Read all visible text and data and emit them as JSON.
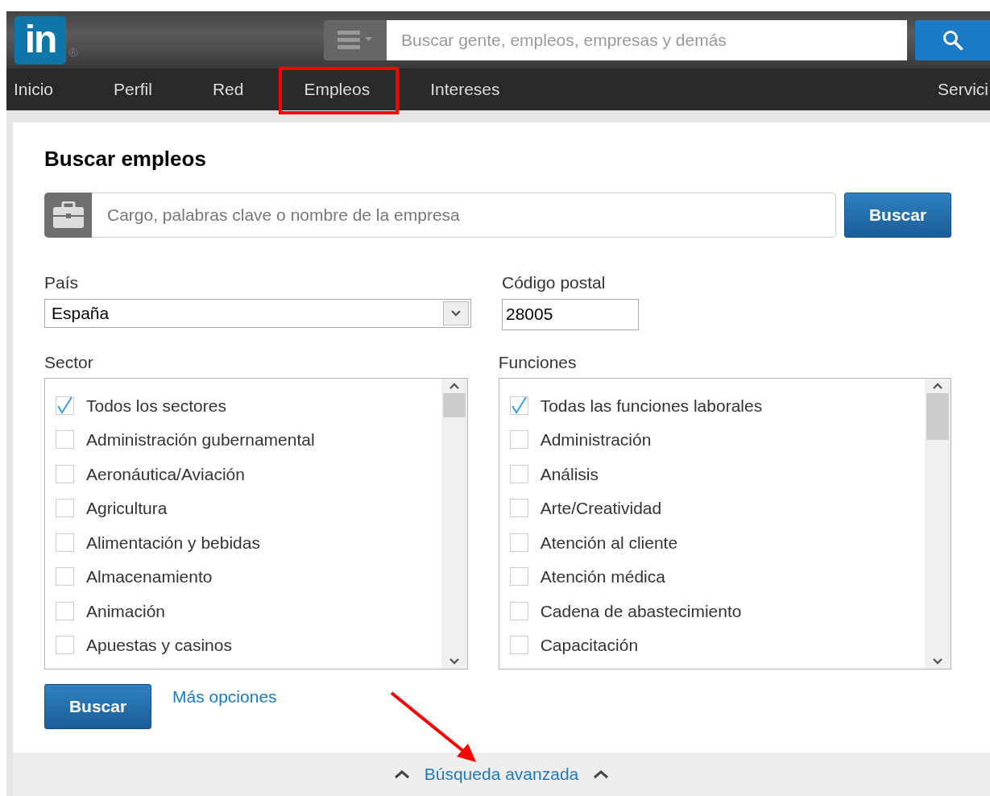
{
  "header": {
    "logo": "in",
    "search": {
      "placeholder": "Buscar gente, empleos, empresas y demás"
    }
  },
  "nav": [
    {
      "label": "Inicio",
      "highlighted": false
    },
    {
      "label": "Perfil",
      "highlighted": false
    },
    {
      "label": "Red",
      "highlighted": false
    },
    {
      "label": "Empleos",
      "highlighted": true
    },
    {
      "label": "Intereses",
      "highlighted": false
    },
    {
      "label": "Servici",
      "highlighted": false
    }
  ],
  "job_search": {
    "title": "Buscar empleos",
    "keyword_placeholder": "Cargo, palabras clave o nombre de la empresa",
    "search_button": "Buscar",
    "country": {
      "label": "País",
      "value": "España"
    },
    "postal_code": {
      "label": "Código postal",
      "value": "28005"
    },
    "sector": {
      "label": "Sector",
      "items": [
        {
          "label": "Todos los sectores",
          "checked": true
        },
        {
          "label": "Administración gubernamental",
          "checked": false
        },
        {
          "label": "Aeronáutica/Aviación",
          "checked": false
        },
        {
          "label": "Agricultura",
          "checked": false
        },
        {
          "label": "Alimentación y bebidas",
          "checked": false
        },
        {
          "label": "Almacenamiento",
          "checked": false
        },
        {
          "label": "Animación",
          "checked": false
        },
        {
          "label": "Apuestas y casinos",
          "checked": false
        }
      ]
    },
    "functions": {
      "label": "Funciones",
      "items": [
        {
          "label": "Todas las funciones laborales",
          "checked": true
        },
        {
          "label": "Administración",
          "checked": false
        },
        {
          "label": "Análisis",
          "checked": false
        },
        {
          "label": "Arte/Creatividad",
          "checked": false
        },
        {
          "label": "Atención al cliente",
          "checked": false
        },
        {
          "label": "Atención médica",
          "checked": false
        },
        {
          "label": "Cadena de abastecimiento",
          "checked": false
        },
        {
          "label": "Capacitación",
          "checked": false
        }
      ]
    },
    "submit_button": "Buscar",
    "more_options": "Más opciones"
  },
  "advanced_search": "Búsqueda avanzada"
}
